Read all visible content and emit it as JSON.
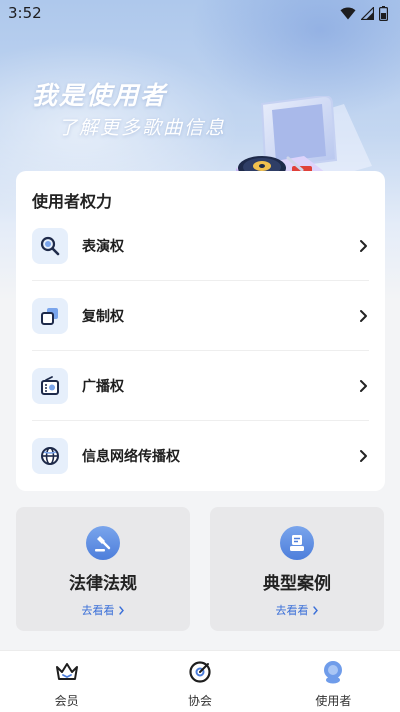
{
  "status_bar": {
    "time": "3:52"
  },
  "hero": {
    "title": "我是使用者",
    "subtitle": "了解更多歌曲信息"
  },
  "rights_card": {
    "title": "使用者权力",
    "items": [
      {
        "label": "表演权",
        "icon": "magnifier-icon"
      },
      {
        "label": "复制权",
        "icon": "copy-squares-icon"
      },
      {
        "label": "广播权",
        "icon": "radio-icon"
      },
      {
        "label": "信息网络传播权",
        "icon": "globe-icon"
      }
    ]
  },
  "info_cards": [
    {
      "title": "法律法规",
      "link": "去看看",
      "icon": "gavel-icon"
    },
    {
      "title": "典型案例",
      "link": "去看看",
      "icon": "document-stack-icon"
    }
  ],
  "tab_bar": {
    "tabs": [
      {
        "label": "会员",
        "icon": "crown-icon"
      },
      {
        "label": "协会",
        "icon": "target-icon"
      },
      {
        "label": "使用者",
        "icon": "user-avatar-icon"
      }
    ],
    "active_index": 2
  },
  "colors": {
    "accent": "#3a6fd8",
    "icon_bg": "#e6effb",
    "card_bg": "#ffffff",
    "info_card_bg": "#e8e8ea",
    "hero_gradient_top": "#aec8ec"
  }
}
